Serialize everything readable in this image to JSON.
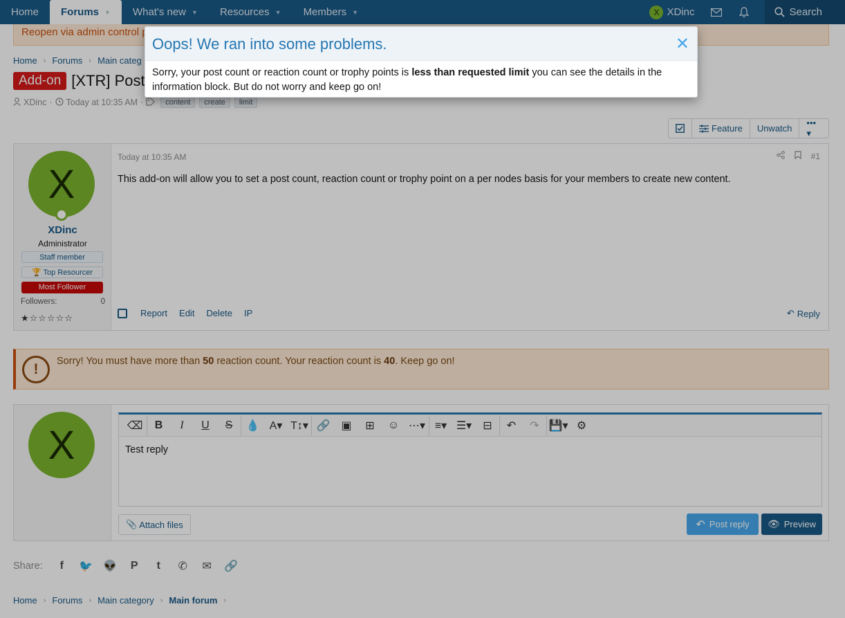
{
  "nav": {
    "tabs": [
      {
        "label": "Home"
      },
      {
        "label": "Forums"
      },
      {
        "label": "What's new"
      },
      {
        "label": "Resources"
      },
      {
        "label": "Members"
      }
    ],
    "user": "XDinc",
    "user_initial": "X",
    "search": "Search"
  },
  "notice": "Reopen via admin control p",
  "breadcrumb": {
    "top": [
      "Home",
      "Forums",
      "Main categ"
    ],
    "bottom": [
      "Home",
      "Forums",
      "Main category",
      "Main forum"
    ]
  },
  "thread": {
    "prefix": "Add-on",
    "title": "[XTR] Post",
    "author": "XDinc",
    "date": "Today at 10:35 AM",
    "tags": [
      "content",
      "create",
      "limit"
    ]
  },
  "thread_actions": {
    "feature": "Feature",
    "unwatch": "Unwatch"
  },
  "post": {
    "username": "XDinc",
    "initial": "X",
    "user_title": "Administrator",
    "banners": [
      "Staff member",
      "Top Resourcer",
      "Most Follower"
    ],
    "followers_label": "Followers:",
    "followers_count": "0",
    "date": "Today at 10:35 AM",
    "number": "#1",
    "body": "This add-on will allow you to set a post count, reaction count or trophy point on a per nodes basis for your members to create new content.",
    "actions": [
      "Report",
      "Edit",
      "Delete",
      "IP"
    ],
    "reply": "Reply"
  },
  "warning": {
    "pre": "Sorry! You must have more than ",
    "required": "50",
    "mid": " reaction count. Your reaction count is ",
    "current": "40",
    "post": ". Keep go on!"
  },
  "editor": {
    "text": "Test reply",
    "attach": "Attach files",
    "post_reply": "Post reply",
    "preview": "Preview"
  },
  "share": {
    "label": "Share:"
  },
  "modal": {
    "title": "Oops! We ran into some problems.",
    "body_pre": "Sorry, your post count or reaction count or trophy points is ",
    "body_bold": "less than requested limit",
    "body_post": " you can see the details in the information block. But do not worry and keep go on!"
  },
  "colors": {
    "nav": "#185886",
    "accent": "#2577b1",
    "avatar": "#7ab32e",
    "addon_badge": "#d41a1a",
    "warning_bg": "#fde9d4"
  }
}
